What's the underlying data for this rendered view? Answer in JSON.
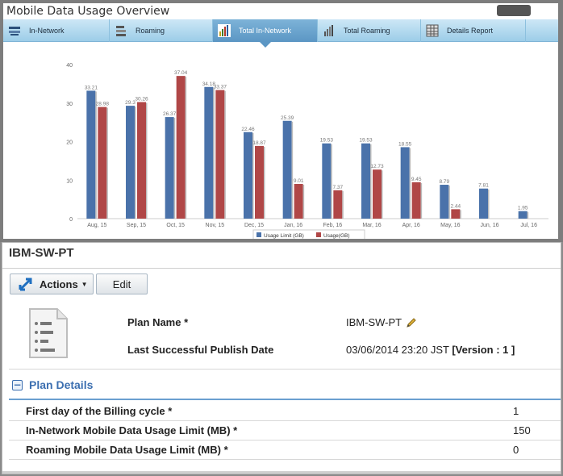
{
  "window": {
    "title": "Mobile Data Usage Overview"
  },
  "tabs": [
    {
      "label": "In-Network",
      "icon": "network-icon"
    },
    {
      "label": "Roaming",
      "icon": "roaming-icon"
    },
    {
      "label": "Total In-Network",
      "icon": "bar-chart-icon",
      "active": true
    },
    {
      "label": "Total Roaming",
      "icon": "bar-chart-icon"
    },
    {
      "label": "Details Report",
      "icon": "grid-report-icon"
    }
  ],
  "chart_data": {
    "type": "bar",
    "categories": [
      "Aug, 15",
      "Sep, 15",
      "Oct, 15",
      "Nov, 15",
      "Dec, 15",
      "Jan, 16",
      "Feb, 16",
      "Mar, 16",
      "Apr, 16",
      "May, 16",
      "Jun, 16",
      "Jul, 16"
    ],
    "series": [
      {
        "name": "Usage Limit (GB)",
        "color": "#4a72aa",
        "values": [
          33.21,
          29.3,
          26.37,
          34.18,
          22.46,
          25.39,
          19.53,
          19.53,
          18.55,
          8.79,
          7.81,
          1.95
        ]
      },
      {
        "name": "Usage(GB)",
        "color": "#b04747",
        "values": [
          28.98,
          30.26,
          37.04,
          33.37,
          18.87,
          9.01,
          7.37,
          12.73,
          9.45,
          2.44,
          null,
          null
        ]
      }
    ],
    "value_labels": [
      [
        "33.21",
        "29.3",
        "26.37",
        "34.18",
        "22.46",
        "25.39",
        "19.53",
        "19.53",
        "18.55",
        "8.79",
        "7.81",
        "1.95"
      ],
      [
        "28.98",
        "30.26",
        "37.04",
        "33.37",
        "18.87",
        "9.01",
        "7.37",
        "12.73",
        "9.45",
        "2.44",
        "",
        ""
      ]
    ],
    "yticks": [
      "0",
      "10",
      "20",
      "30",
      "40"
    ],
    "ylim": [
      0,
      40
    ],
    "legend_position": "bottom-center",
    "grid": false
  },
  "plan": {
    "title": "IBM-SW-PT",
    "actions_label": "Actions",
    "edit_label": "Edit",
    "name_label": "Plan Name *",
    "name_value": "IBM-SW-PT",
    "publish_label": "Last Successful Publish Date",
    "publish_value": "03/06/2014 23:20 JST",
    "version_value": "[Version : 1 ]"
  },
  "details": {
    "title": "Plan Details",
    "rows": [
      {
        "label": "First day of the Billing cycle *",
        "value": "1"
      },
      {
        "label": "In-Network Mobile Data Usage Limit (MB) *",
        "value": "150"
      },
      {
        "label": "Roaming Mobile Data Usage Limit (MB) *",
        "value": "0"
      }
    ]
  }
}
